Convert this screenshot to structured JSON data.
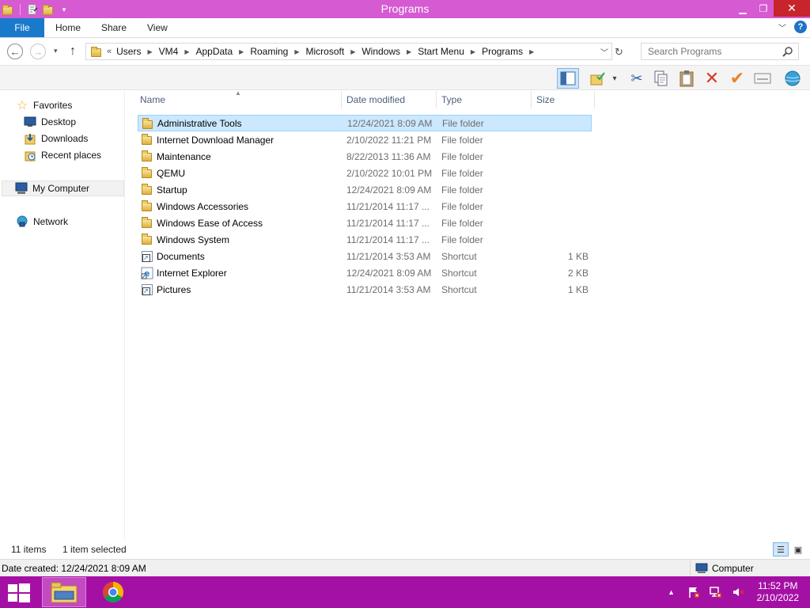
{
  "window": {
    "title": "Programs"
  },
  "ribbon": {
    "file": "File",
    "tabs": [
      "Home",
      "Share",
      "View"
    ]
  },
  "address": {
    "prefix": "«",
    "crumbs": [
      "Users",
      "VM4",
      "AppData",
      "Roaming",
      "Microsoft",
      "Windows",
      "Start Menu",
      "Programs"
    ]
  },
  "search": {
    "placeholder": "Search Programs"
  },
  "nav": {
    "favorites": "Favorites",
    "desktop": "Desktop",
    "downloads": "Downloads",
    "recent": "Recent places",
    "computer": "My Computer",
    "network": "Network"
  },
  "columns": {
    "name": "Name",
    "date": "Date modified",
    "type": "Type",
    "size": "Size"
  },
  "files": [
    {
      "name": "Administrative Tools",
      "date": "12/24/2021 8:09 AM",
      "type": "File folder",
      "size": "",
      "kind": "folder"
    },
    {
      "name": "Internet Download Manager",
      "date": "2/10/2022 11:21 PM",
      "type": "File folder",
      "size": "",
      "kind": "folder"
    },
    {
      "name": "Maintenance",
      "date": "8/22/2013 11:36 AM",
      "type": "File folder",
      "size": "",
      "kind": "folder"
    },
    {
      "name": "QEMU",
      "date": "2/10/2022 10:01 PM",
      "type": "File folder",
      "size": "",
      "kind": "folder"
    },
    {
      "name": "Startup",
      "date": "12/24/2021 8:09 AM",
      "type": "File folder",
      "size": "",
      "kind": "folder"
    },
    {
      "name": "Windows Accessories",
      "date": "11/21/2014 11:17 ...",
      "type": "File folder",
      "size": "",
      "kind": "folder"
    },
    {
      "name": "Windows Ease of Access",
      "date": "11/21/2014 11:17 ...",
      "type": "File folder",
      "size": "",
      "kind": "folder"
    },
    {
      "name": "Windows System",
      "date": "11/21/2014 11:17 ...",
      "type": "File folder",
      "size": "",
      "kind": "folder"
    },
    {
      "name": "Documents",
      "date": "11/21/2014 3:53 AM",
      "type": "Shortcut",
      "size": "1 KB",
      "kind": "shortcut"
    },
    {
      "name": "Internet Explorer",
      "date": "12/24/2021 8:09 AM",
      "type": "Shortcut",
      "size": "2 KB",
      "kind": "shortcut"
    },
    {
      "name": "Pictures",
      "date": "11/21/2014 3:53 AM",
      "type": "Shortcut",
      "size": "1 KB",
      "kind": "shortcut"
    }
  ],
  "status": {
    "count": "11 items",
    "selected": "1 item selected"
  },
  "details": {
    "created": "Date created: 12/24/2021 8:09 AM",
    "computer": "Computer"
  },
  "clock": {
    "time": "11:52 PM",
    "date": "2/10/2022"
  },
  "colors": {
    "titlebar": "#d65ad2",
    "taskbar": "#a510a4",
    "file_tab": "#1979ca",
    "selection": "#cce8ff"
  }
}
